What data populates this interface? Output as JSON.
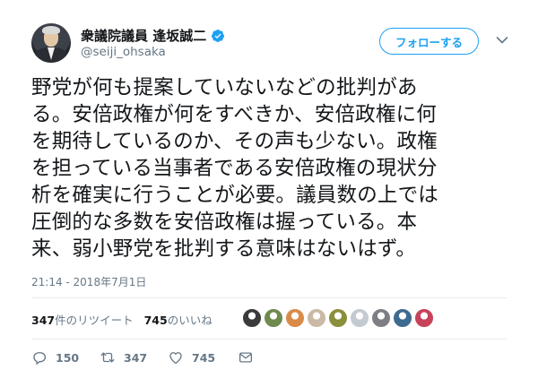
{
  "header": {
    "display_name": "衆議院議員 逢坂誠二",
    "handle": "@seiji_ohsaka",
    "follow_label": "フォローする"
  },
  "tweet": {
    "lines": [
      "野党が何も提案していないなどの批判があ",
      "る。安倍政権が何をすべきか、安倍政権に何",
      "を期待しているのか、その声も少ない。政権",
      "を担っている当事者である安倍政権の現状分",
      "析を確実に行うことが必要。議員数の上では",
      "圧倒的な多数を安倍政権は握っている。本",
      "来、弱小野党を批判する意味はないはず。"
    ],
    "timestamp": "21:14 - 2018年7月1日"
  },
  "stats": {
    "retweets_count": "347",
    "retweets_label": "件のリツイート",
    "likes_count": "745",
    "likes_label": "のいいね"
  },
  "likers": [
    {
      "icon": "liker-avatar-1",
      "color": "#3b3b3b"
    },
    {
      "icon": "liker-avatar-2",
      "color": "#6f8a4e"
    },
    {
      "icon": "liker-avatar-3",
      "color": "#d98b4a"
    },
    {
      "icon": "liker-avatar-4",
      "color": "#c9b9a6"
    },
    {
      "icon": "liker-avatar-5",
      "color": "#8a8f3a"
    },
    {
      "icon": "liker-avatar-6",
      "color": "#c3cad1"
    },
    {
      "icon": "liker-avatar-7",
      "color": "#7d7f84"
    },
    {
      "icon": "liker-avatar-8",
      "color": "#3e6a8f"
    },
    {
      "icon": "liker-avatar-9",
      "color": "#c8435a"
    }
  ],
  "actions": {
    "reply_count": "150",
    "retweet_count": "347",
    "like_count": "745"
  },
  "colors": {
    "accent": "#1da1f2",
    "secondary_text": "#657786",
    "divider": "#e6ecf0"
  }
}
